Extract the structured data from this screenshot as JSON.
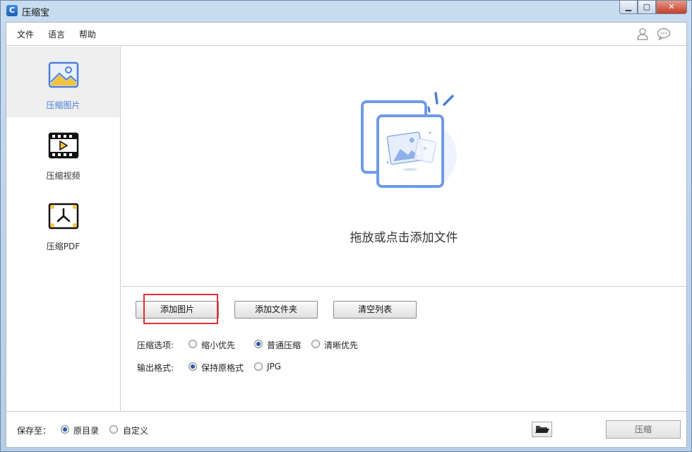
{
  "window": {
    "title": "压缩宝"
  },
  "menu": {
    "file": "文件",
    "language": "语言",
    "help": "帮助",
    "user_icon": "user-icon",
    "chat_icon": "chat-icon"
  },
  "sidebar": {
    "items": [
      {
        "label": "压缩图片",
        "icon": "image-icon",
        "active": true
      },
      {
        "label": "压缩视频",
        "icon": "video-icon",
        "active": false
      },
      {
        "label": "压缩PDF",
        "icon": "pdf-icon",
        "active": false
      }
    ]
  },
  "dropzone": {
    "text": "拖放或点击添加文件",
    "icon": "add-images-illustration"
  },
  "buttons": {
    "add_image": "添加图片",
    "add_folder": "添加文件夹",
    "clear_list": "清空列表"
  },
  "options": {
    "compression_label": "压缩选项:",
    "compression": [
      {
        "label": "缩小优先",
        "checked": false
      },
      {
        "label": "普通压缩",
        "checked": true
      },
      {
        "label": "清晰优先",
        "checked": false
      }
    ],
    "format_label": "输出格式:",
    "format": [
      {
        "label": "保持原格式",
        "checked": true
      },
      {
        "label": "JPG",
        "checked": false
      }
    ]
  },
  "save": {
    "label": "保存至：",
    "options": [
      {
        "label": "原目录",
        "checked": true
      },
      {
        "label": "自定义",
        "checked": false
      }
    ],
    "folder_icon": "folder-open-icon",
    "compress_button": "压缩"
  },
  "colors": {
    "accent": "#4d7fd6",
    "highlight": "#e03030",
    "icon_yellow": "#f5c33b"
  }
}
